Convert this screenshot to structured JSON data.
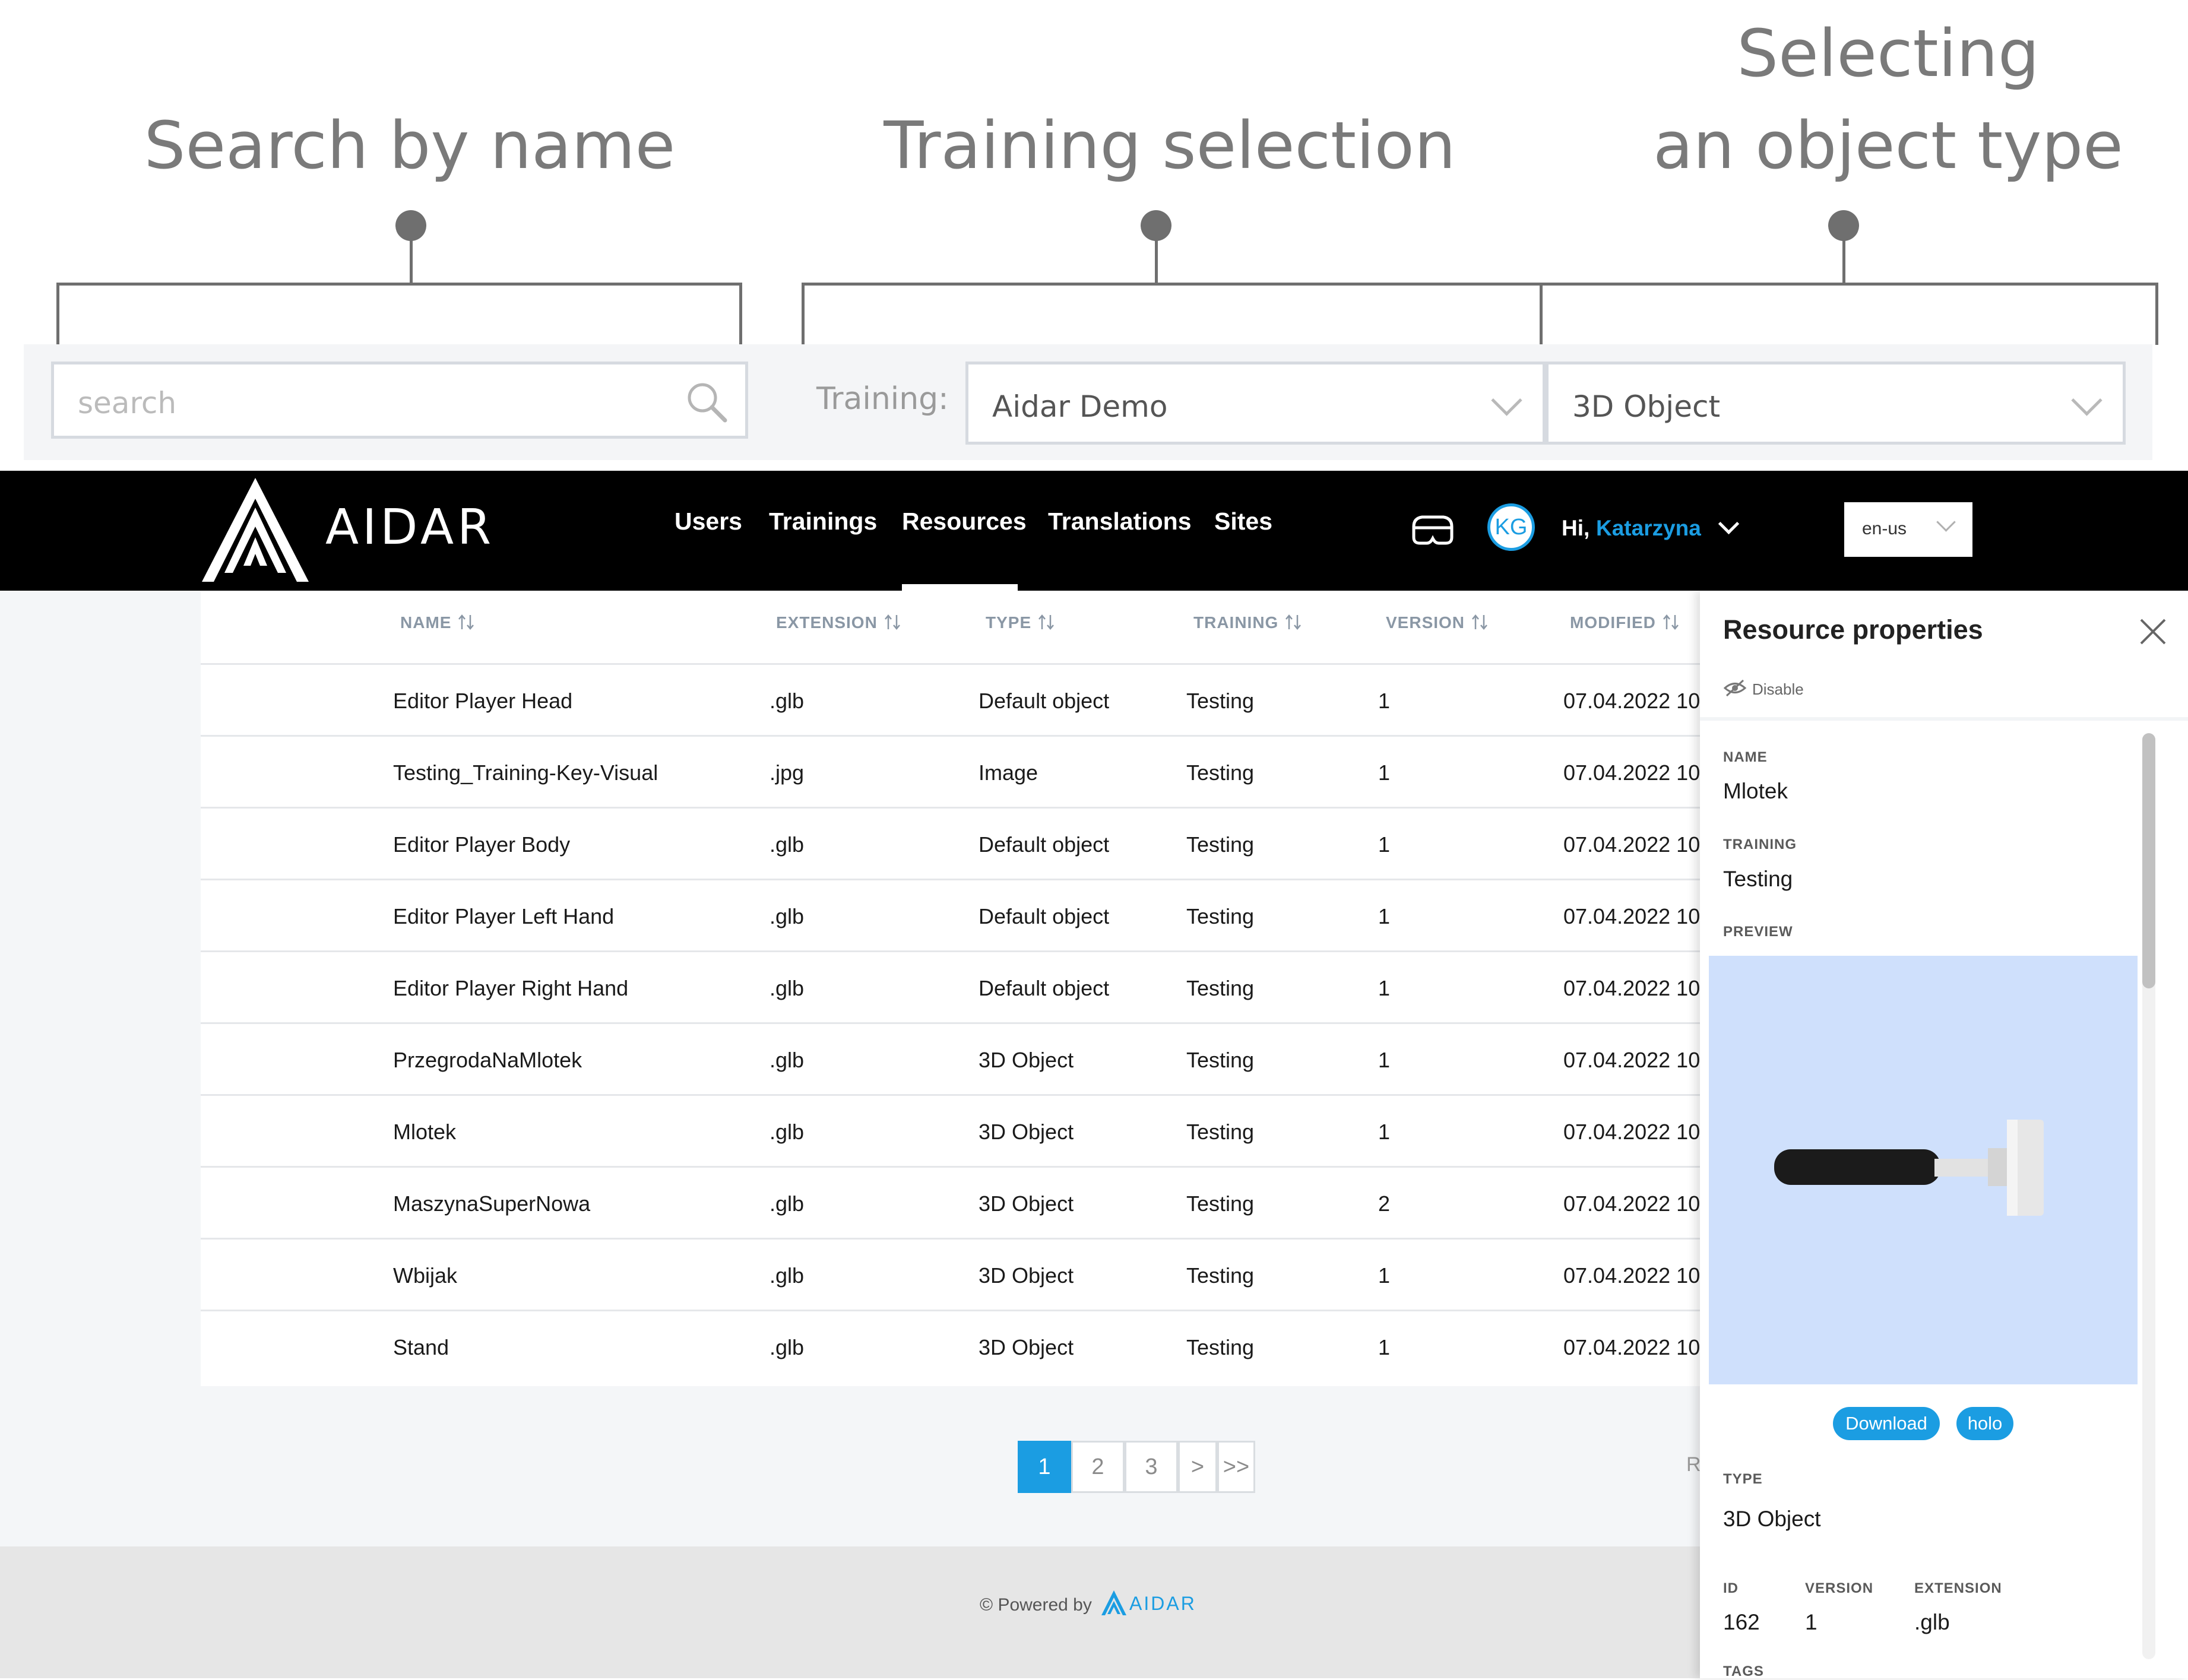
{
  "annotations": {
    "search": "Search by name",
    "training": "Training selection",
    "type_line1": "Selecting",
    "type_line2": "an object type"
  },
  "filters": {
    "search_placeholder": "search",
    "training_label": "Training:",
    "training_value": "Aidar Demo",
    "type_value": "3D Object"
  },
  "nav": {
    "brand": "AIDAR",
    "items": [
      "Users",
      "Trainings",
      "Resources",
      "Translations",
      "Sites"
    ],
    "active": "Resources",
    "avatar_initials": "KG",
    "greeting": "Hi,",
    "user_name": "Katarzyna",
    "language": "en-us"
  },
  "table": {
    "columns": [
      "NAME",
      "EXTENSION",
      "TYPE",
      "TRAINING",
      "VERSION",
      "MODIFIED"
    ],
    "rows": [
      {
        "name": "Editor Player Head",
        "ext": ".glb",
        "type": "Default object",
        "training": "Testing",
        "version": "1",
        "modified": "07.04.2022 10"
      },
      {
        "name": "Testing_Training-Key-Visual",
        "ext": ".jpg",
        "type": "Image",
        "training": "Testing",
        "version": "1",
        "modified": "07.04.2022 10"
      },
      {
        "name": "Editor Player Body",
        "ext": ".glb",
        "type": "Default object",
        "training": "Testing",
        "version": "1",
        "modified": "07.04.2022 10"
      },
      {
        "name": "Editor Player Left Hand",
        "ext": ".glb",
        "type": "Default object",
        "training": "Testing",
        "version": "1",
        "modified": "07.04.2022 10"
      },
      {
        "name": "Editor Player Right Hand",
        "ext": ".glb",
        "type": "Default object",
        "training": "Testing",
        "version": "1",
        "modified": "07.04.2022 10"
      },
      {
        "name": "PrzegrodaNaMlotek",
        "ext": ".glb",
        "type": "3D Object",
        "training": "Testing",
        "version": "1",
        "modified": "07.04.2022 10"
      },
      {
        "name": "Mlotek",
        "ext": ".glb",
        "type": "3D Object",
        "training": "Testing",
        "version": "1",
        "modified": "07.04.2022 10"
      },
      {
        "name": "MaszynaSuperNowa",
        "ext": ".glb",
        "type": "3D Object",
        "training": "Testing",
        "version": "2",
        "modified": "07.04.2022 10"
      },
      {
        "name": "Wbijak",
        "ext": ".glb",
        "type": "3D Object",
        "training": "Testing",
        "version": "1",
        "modified": "07.04.2022 10"
      },
      {
        "name": "Stand",
        "ext": ".glb",
        "type": "3D Object",
        "training": "Testing",
        "version": "1",
        "modified": "07.04.2022 10"
      }
    ]
  },
  "pagination": {
    "pages": [
      "1",
      "2",
      "3"
    ],
    "next": ">",
    "last": ">>",
    "active": "1",
    "trailing_text": "R"
  },
  "footer": {
    "powered_by": "© Powered by",
    "brand": "AIDAR"
  },
  "panel": {
    "title": "Resource properties",
    "disable_label": "Disable",
    "name_label": "NAME",
    "name_value": "Mlotek",
    "training_label": "TRAINING",
    "training_value": "Testing",
    "preview_label": "PREVIEW",
    "download_label": "Download",
    "holo_label": "holo",
    "type_label": "TYPE",
    "type_value": "3D Object",
    "id_label": "ID",
    "id_value": "162",
    "version_label": "VERSION",
    "version_value": "1",
    "extension_label": "EXTENSION",
    "extension_value": ".glb",
    "tags_label": "TAGS"
  },
  "colors": {
    "accent": "#1b9de2",
    "nav_bg": "#000000",
    "preview_bg": "#cfe0fc"
  }
}
